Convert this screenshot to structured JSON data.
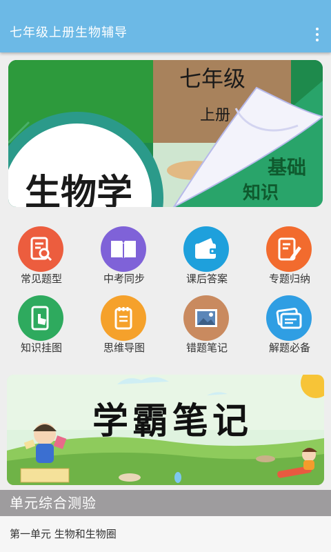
{
  "appbar": {
    "title": "七年级上册生物辅导",
    "menu_icon": "more-vert-icon"
  },
  "banner": {
    "subject": "生物学",
    "grade": "七年级",
    "volume": "上册",
    "tag_line1": "基础",
    "tag_line2": "知识"
  },
  "menu": {
    "items": [
      {
        "label": "常见题型",
        "icon": "document-search-icon",
        "color": "#ec5d3e"
      },
      {
        "label": "中考同步",
        "icon": "open-book-icon",
        "color": "#7f62d8"
      },
      {
        "label": "课后答案",
        "icon": "wallet-icon",
        "color": "#1ea0dc"
      },
      {
        "label": "专题归纳",
        "icon": "note-pencil-icon",
        "color": "#f26b2e"
      },
      {
        "label": "知识挂图",
        "icon": "tablet-hand-icon",
        "color": "#2eaa5e"
      },
      {
        "label": "思维导图",
        "icon": "notepad-icon",
        "color": "#f5a12b"
      },
      {
        "label": "错题笔记",
        "icon": "image-frame-icon",
        "color": "#c98a5f"
      },
      {
        "label": "解题必备",
        "icon": "cards-icon",
        "color": "#2f9ee3"
      }
    ]
  },
  "promo": {
    "title": "学霸笔记"
  },
  "section": {
    "title": "单元综合测验"
  },
  "list": {
    "items": [
      {
        "label": "第一单元 生物和生物圈"
      }
    ]
  },
  "colors": {
    "appbar": "#6cb9e6",
    "section_bar": "#9e9c9e"
  }
}
